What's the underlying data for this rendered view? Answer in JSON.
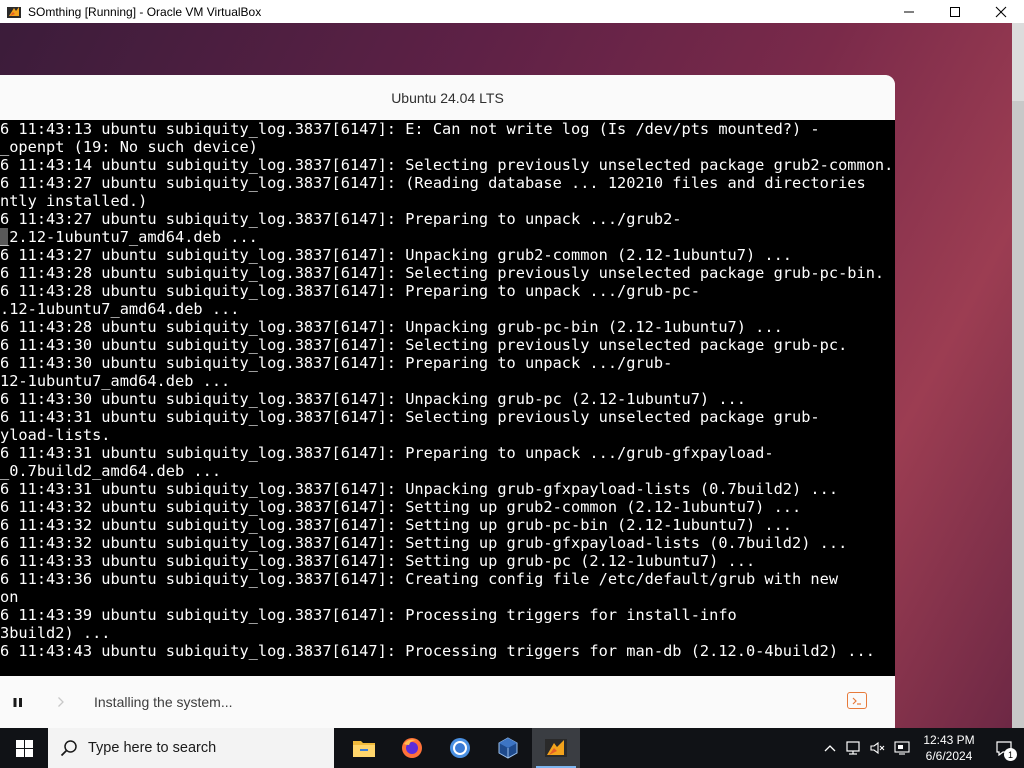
{
  "window": {
    "title": "SOmthing [Running] - Oracle VM VirtualBox"
  },
  "installer": {
    "title": "Ubuntu 24.04 LTS",
    "status_text": "Installing the system..."
  },
  "terminal": {
    "lines": [
      "6 11:43:13 ubuntu subiquity_log.3837[6147]: E: Can not write log (Is /dev/pts mounted?) -",
      "_openpt (19: No such device)",
      "6 11:43:14 ubuntu subiquity_log.3837[6147]: Selecting previously unselected package grub2-common.",
      "6 11:43:27 ubuntu subiquity_log.3837[6147]: (Reading database ... 120210 files and directories",
      "ntly installed.)",
      "6 11:43:27 ubuntu subiquity_log.3837[6147]: Preparing to unpack .../grub2-",
      "_2.12-1ubuntu7_amd64.deb ...",
      "6 11:43:27 ubuntu subiquity_log.3837[6147]: Unpacking grub2-common (2.12-1ubuntu7) ...",
      "6 11:43:28 ubuntu subiquity_log.3837[6147]: Selecting previously unselected package grub-pc-bin.",
      "6 11:43:28 ubuntu subiquity_log.3837[6147]: Preparing to unpack .../grub-pc-",
      ".12-1ubuntu7_amd64.deb ...",
      "6 11:43:28 ubuntu subiquity_log.3837[6147]: Unpacking grub-pc-bin (2.12-1ubuntu7) ...",
      "6 11:43:30 ubuntu subiquity_log.3837[6147]: Selecting previously unselected package grub-pc.",
      "6 11:43:30 ubuntu subiquity_log.3837[6147]: Preparing to unpack .../grub-",
      "12-1ubuntu7_amd64.deb ...",
      "6 11:43:30 ubuntu subiquity_log.3837[6147]: Unpacking grub-pc (2.12-1ubuntu7) ...",
      "6 11:43:31 ubuntu subiquity_log.3837[6147]: Selecting previously unselected package grub-",
      "yload-lists.",
      "6 11:43:31 ubuntu subiquity_log.3837[6147]: Preparing to unpack .../grub-gfxpayload-",
      "_0.7build2_amd64.deb ...",
      "6 11:43:31 ubuntu subiquity_log.3837[6147]: Unpacking grub-gfxpayload-lists (0.7build2) ...",
      "6 11:43:32 ubuntu subiquity_log.3837[6147]: Setting up grub2-common (2.12-1ubuntu7) ...",
      "6 11:43:32 ubuntu subiquity_log.3837[6147]: Setting up grub-pc-bin (2.12-1ubuntu7) ...",
      "6 11:43:32 ubuntu subiquity_log.3837[6147]: Setting up grub-gfxpayload-lists (0.7build2) ...",
      "6 11:43:33 ubuntu subiquity_log.3837[6147]: Setting up grub-pc (2.12-1ubuntu7) ...",
      "6 11:43:36 ubuntu subiquity_log.3837[6147]: Creating config file /etc/default/grub with new",
      "on",
      "6 11:43:39 ubuntu subiquity_log.3837[6147]: Processing triggers for install-info",
      "3build2) ...",
      "6 11:43:43 ubuntu subiquity_log.3837[6147]: Processing triggers for man-db (2.12.0-4build2) ..."
    ]
  },
  "taskbar": {
    "search_placeholder": "Type here to search",
    "apps": [
      {
        "name": "file-explorer",
        "icon": "folder-icon"
      },
      {
        "name": "firefox",
        "icon": "firefox-icon"
      },
      {
        "name": "chrome",
        "icon": "chrome-icon"
      },
      {
        "name": "virtualbox",
        "icon": "virtualbox-icon"
      },
      {
        "name": "vm-running",
        "icon": "vm-window-icon",
        "active": true
      }
    ],
    "time": "12:43 PM",
    "date": "6/6/2024",
    "notification_count": "1"
  },
  "colors": {
    "accent_orange": "#e77a3a",
    "terminal_bg": "#000000",
    "taskbar_bg": "#101216"
  }
}
